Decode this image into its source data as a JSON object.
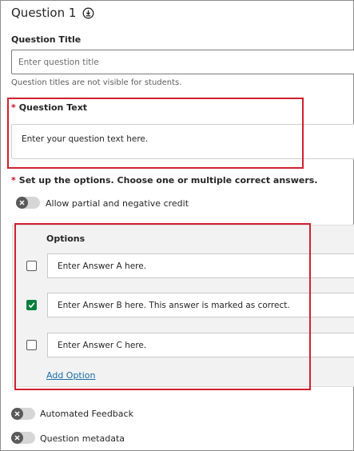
{
  "question": {
    "heading": "Question 1",
    "title_label": "Question Title",
    "title_placeholder": "Enter question title",
    "title_helper": "Question titles are not visible for students.",
    "text_label": "Question Text",
    "text_value": "Enter your question text here.",
    "options_instruction": "Set up the options. Choose one or multiple correct answers.",
    "required_marker": "*"
  },
  "toggles": {
    "partial_credit": {
      "label": "Allow partial and negative credit",
      "on": false
    },
    "automated_feedback": {
      "label": "Automated Feedback",
      "on": false
    },
    "question_metadata": {
      "label": "Question metadata",
      "on": false
    }
  },
  "options": {
    "heading": "Options",
    "items": [
      {
        "text": "Enter Answer A here.",
        "correct": false
      },
      {
        "text": "Enter Answer B here. This answer is marked as correct.",
        "correct": true
      },
      {
        "text": "Enter Answer C here.",
        "correct": false
      }
    ],
    "add_label": "Add Option"
  },
  "colors": {
    "required": "#c8102e",
    "highlight": "#d0202e",
    "correct": "#0a7f3f",
    "link": "#1a6ea8"
  }
}
